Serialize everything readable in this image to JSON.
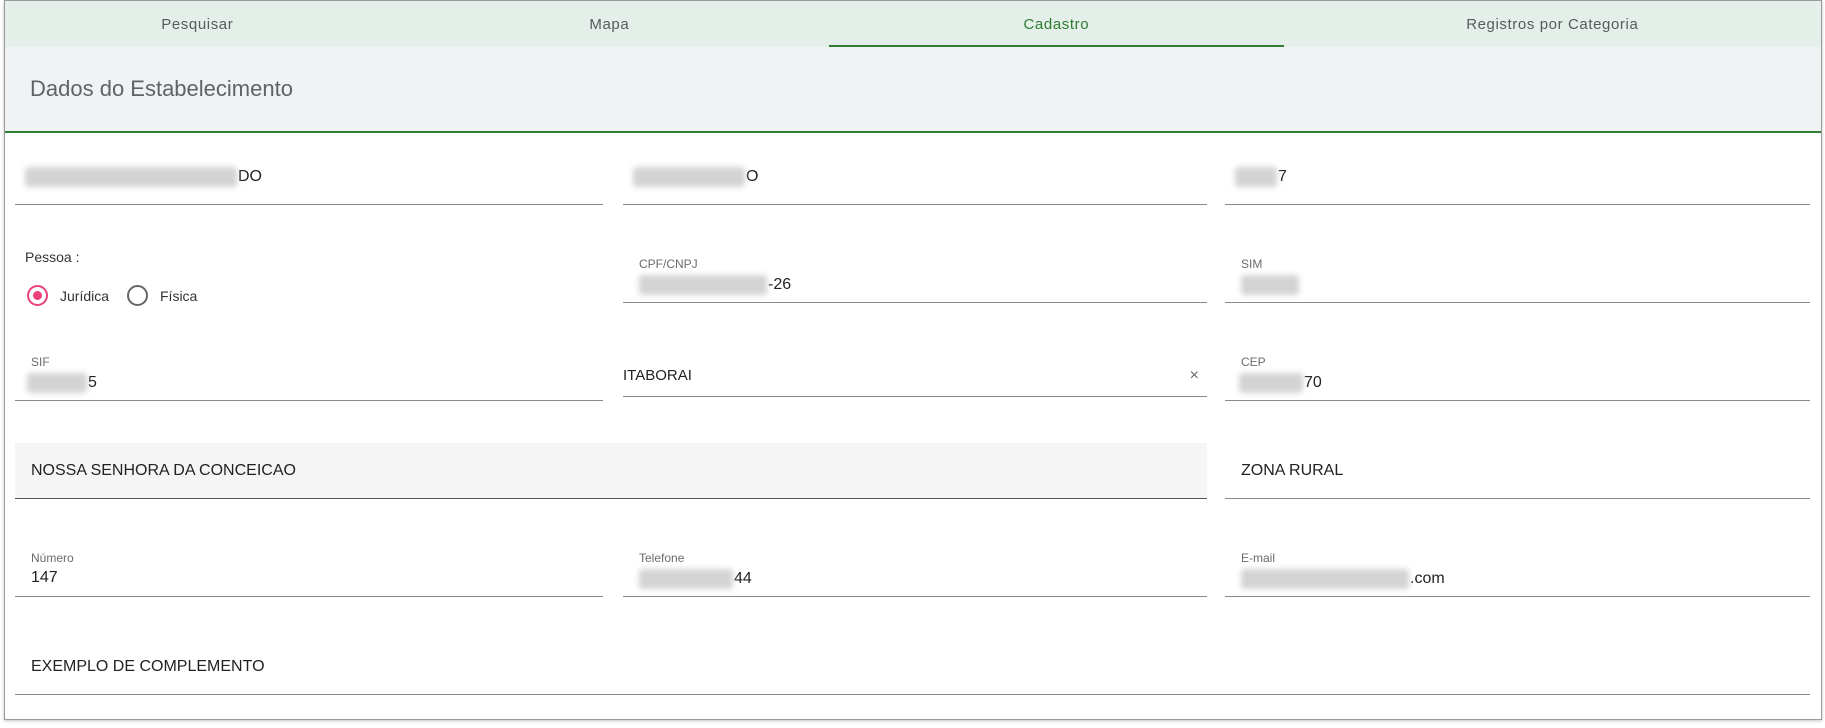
{
  "tabs": [
    {
      "label": "Pesquisar"
    },
    {
      "label": "Mapa"
    },
    {
      "label": "Cadastro"
    },
    {
      "label": "Registros por Categoria"
    }
  ],
  "header": {
    "title": "Dados do Estabelecimento"
  },
  "row1": {
    "name_suffix": "DO",
    "fantasy_suffix": "O",
    "code_suffix": "7"
  },
  "pessoa": {
    "label": "Pessoa :",
    "options": [
      "Jurídica",
      "Física"
    ],
    "selected": "Jurídica"
  },
  "cpf": {
    "label": "CPF/CNPJ",
    "suffix": "-26"
  },
  "sim": {
    "label": "SIM"
  },
  "sif": {
    "label": "SIF",
    "suffix": "5"
  },
  "city": {
    "value": "ITABORAI",
    "clear": "×"
  },
  "cep": {
    "label": "CEP",
    "suffix": "70"
  },
  "bairro": {
    "value": "NOSSA SENHORA DA CONCEICAO"
  },
  "zona": {
    "value": "ZONA RURAL"
  },
  "numero": {
    "label": "Número",
    "value": "147"
  },
  "telefone": {
    "label": "Telefone",
    "suffix": "44"
  },
  "email": {
    "label": "E-mail",
    "suffix": ".com"
  },
  "complemento": {
    "value": "EXEMPLO DE COMPLEMENTO"
  },
  "colors": {
    "accent": "#2e7d32",
    "radio": "#ec407a",
    "tabbar": "#e4efe9"
  }
}
